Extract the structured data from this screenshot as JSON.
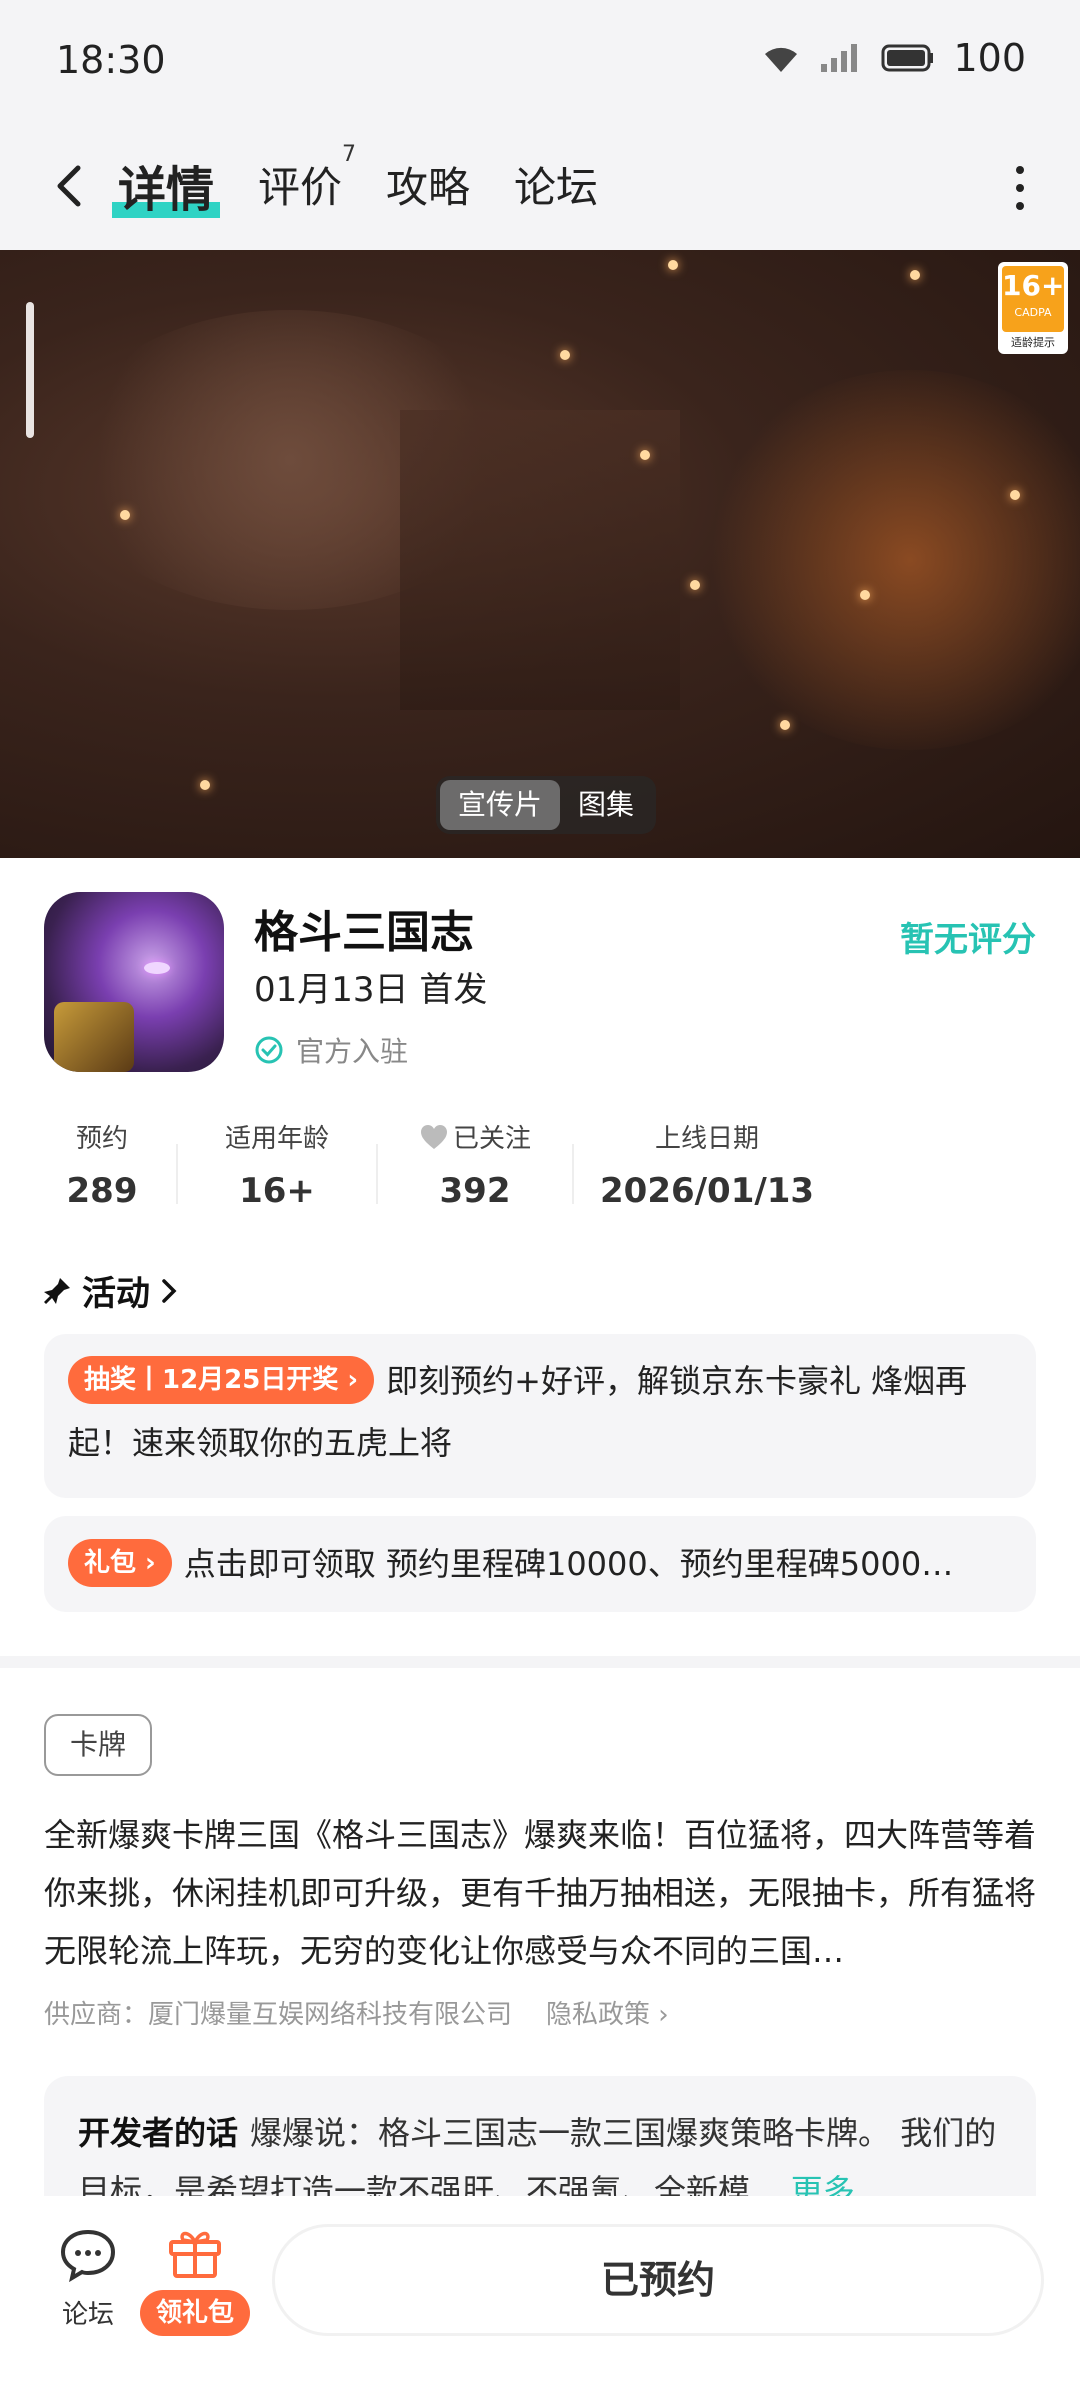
{
  "status_bar": {
    "time": "18:30",
    "battery": "100"
  },
  "nav": {
    "tabs": [
      {
        "label": "详情",
        "active": true
      },
      {
        "label": "评价",
        "badge": "7"
      },
      {
        "label": "攻略"
      },
      {
        "label": "论坛"
      }
    ]
  },
  "media": {
    "age_rating": "16+",
    "age_org": "CADPA",
    "age_tip": "适龄提示",
    "toggle": [
      "宣传片",
      "图集"
    ]
  },
  "game": {
    "name": "格斗三国志",
    "release": "01月13日 首发",
    "official": "官方入驻",
    "score": "暂无评分"
  },
  "stats": [
    {
      "label": "预约",
      "value": "289"
    },
    {
      "label": "适用年龄",
      "value": "16+"
    },
    {
      "label": "已关注",
      "value": "392"
    },
    {
      "label": "上线日期",
      "value": "2026/01/13"
    }
  ],
  "activity": {
    "title": "活动",
    "items": [
      {
        "tag": "抽奖丨12月25日开奖 ›",
        "text": "即刻预约+好评，解锁京东卡豪礼 烽烟再起！速来领取你的五虎上将"
      },
      {
        "tag": "礼包 ›",
        "text": "点击即可领取 预约里程碑10000、预约里程碑5000…"
      }
    ]
  },
  "detail": {
    "tag": "卡牌",
    "description": "全新爆爽卡牌三国《格斗三国志》爆爽来临！百位猛将，四大阵营等着你来挑，休闲挂机即可升级，更有千抽万抽相送，无限抽卡，所有猛将无限轮流上阵玩，无穷的变化让你感受与众不同的三国…",
    "supplier": "供应商：厦门爆量互娱网络科技有限公司",
    "privacy": "隐私政策 ›",
    "dev_title": "开发者的话",
    "dev_text": "爆爆说：格斗三国志一款三国爆爽策略卡牌。 我们的目标，是希望打造一款不强肝、不强氪、全新模 ...",
    "dev_more": "更多"
  },
  "bottom_bar": {
    "forum": "论坛",
    "gift": "领礼包",
    "reserve": "已预约"
  },
  "colors": {
    "accent": "#27c3b3",
    "orange": "#ff6b3d",
    "highlight": "#2fd3c4"
  }
}
